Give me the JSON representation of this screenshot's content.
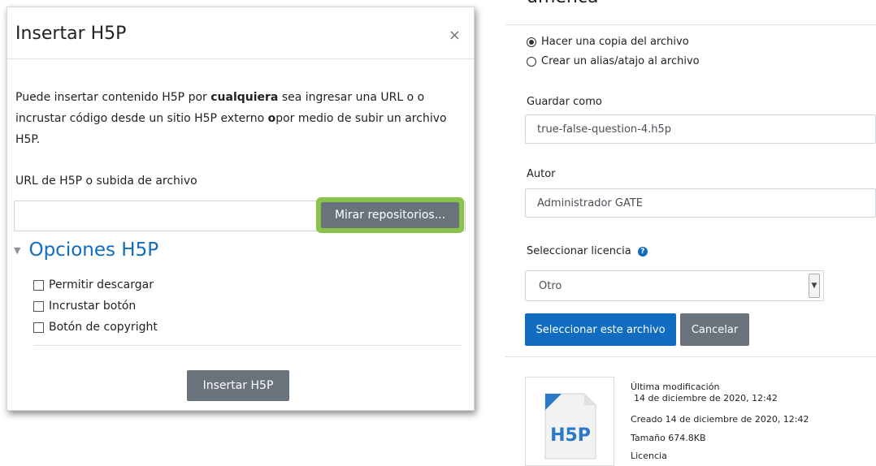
{
  "dialog": {
    "title": "Insertar H5P",
    "close_symbol": "×",
    "description": {
      "part1": "Puede insertar contenido H5P por ",
      "bold1": "cualquiera",
      "part2": " sea ingresar una URL o o incrustar código desde un sitio H5P externo ",
      "bold2": "o",
      "part3": "por medio de subir un archivo H5P."
    },
    "url_label": "URL de H5P o subida de archivo",
    "url_value": "",
    "browse_button": "Mirar repositorios...",
    "options_caret": "▼",
    "options_title": "Opciones H5P",
    "options": [
      {
        "label": "Permitir descargar",
        "checked": false
      },
      {
        "label": "Incrustar botón",
        "checked": false
      },
      {
        "label": "Botón de copyright",
        "checked": false
      }
    ],
    "insert_button": "Insertar H5P",
    "highlight_color": "#8bc34a"
  },
  "file_panel": {
    "header_fragment": "uméncá",
    "radios": [
      {
        "label": "Hacer una copia del archivo",
        "selected": true
      },
      {
        "label": "Crear un alias/atajo al archivo",
        "selected": false
      }
    ],
    "save_as_label": "Guardar como",
    "save_as_value": "true-false-question-4.h5p",
    "author_label": "Autor",
    "author_value": "Administrador GATE",
    "license_label": "Seleccionar licencia",
    "license_value": "Otro",
    "select_button": "Seleccionar este archivo",
    "cancel_button": "Cancelar",
    "thumbnail_text": "H5P",
    "meta": {
      "modified_label": "Última modificación",
      "modified_value": "14 de diciembre de 2020, 12:42",
      "created": "Creado 14 de diciembre de 2020, 12:42",
      "size": "Tamaño 674.8KB",
      "license_label": "Licencia"
    },
    "primary_color": "#0f6cbf"
  }
}
